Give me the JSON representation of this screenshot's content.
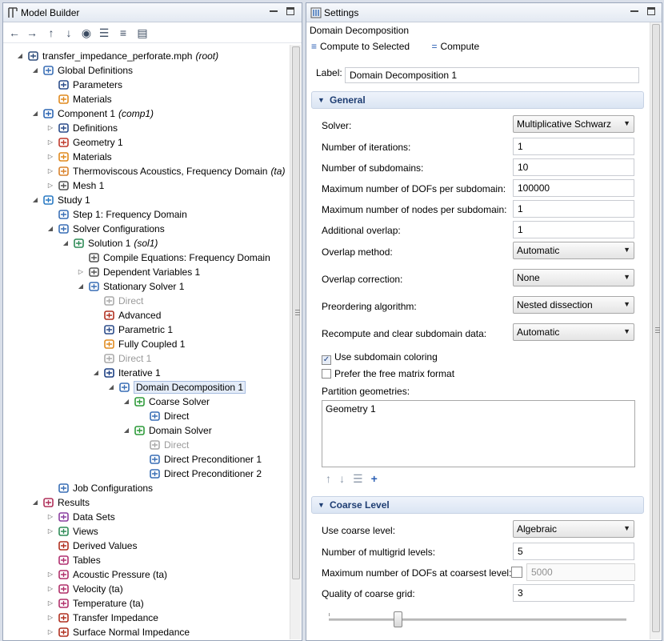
{
  "model_builder": {
    "title": "Model Builder",
    "tree": [
      {
        "label": "transfer_impedance_perforate.mph",
        "suffix": "(root)",
        "icon": "root-file-icon"
      },
      {
        "label": "Global Definitions",
        "icon": "globe-icon"
      },
      {
        "label": "Parameters",
        "icon": "parameters-icon"
      },
      {
        "label": "Materials",
        "icon": "materials-icon"
      },
      {
        "label": "Component 1",
        "suffix": "(comp1)",
        "icon": "component-icon"
      },
      {
        "label": "Definitions",
        "icon": "definitions-icon"
      },
      {
        "label": "Geometry 1",
        "icon": "geometry-icon"
      },
      {
        "label": "Materials",
        "icon": "materials-icon"
      },
      {
        "label": "Thermoviscous Acoustics, Frequency Domain",
        "suffix": "(ta)",
        "icon": "acoustics-physics-icon"
      },
      {
        "label": "Mesh 1",
        "icon": "mesh-icon"
      },
      {
        "label": "Study 1",
        "icon": "study-icon"
      },
      {
        "label": "Step 1: Frequency Domain",
        "icon": "frequency-step-icon"
      },
      {
        "label": "Solver Configurations",
        "icon": "solver-configurations-icon"
      },
      {
        "label": "Solution 1",
        "suffix": "(sol1)",
        "icon": "solution-icon"
      },
      {
        "label": "Compile Equations: Frequency Domain",
        "icon": "compile-equations-icon"
      },
      {
        "label": "Dependent Variables 1",
        "icon": "dependent-variables-icon"
      },
      {
        "label": "Stationary Solver 1",
        "icon": "stationary-solver-icon"
      },
      {
        "label": "Direct",
        "icon": "direct-solver-icon"
      },
      {
        "label": "Advanced",
        "icon": "advanced-icon"
      },
      {
        "label": "Parametric 1",
        "icon": "parametric-icon"
      },
      {
        "label": "Fully Coupled 1",
        "icon": "fully-coupled-icon"
      },
      {
        "label": "Direct 1",
        "icon": "direct-solver-icon"
      },
      {
        "label": "Iterative 1",
        "icon": "iterative-solver-icon"
      },
      {
        "label": "Domain Decomposition 1",
        "icon": "domain-decomposition-icon"
      },
      {
        "label": "Coarse Solver",
        "icon": "coarse-solver-icon"
      },
      {
        "label": "Direct",
        "icon": "direct-solver-icon"
      },
      {
        "label": "Domain Solver",
        "icon": "domain-solver-icon"
      },
      {
        "label": "Direct",
        "icon": "direct-solver-icon"
      },
      {
        "label": "Direct Preconditioner 1",
        "icon": "direct-preconditioner-icon"
      },
      {
        "label": "Direct Preconditioner 2",
        "icon": "direct-preconditioner-icon"
      },
      {
        "label": "Job Configurations",
        "icon": "job-configurations-icon"
      },
      {
        "label": "Results",
        "icon": "results-icon"
      },
      {
        "label": "Data Sets",
        "icon": "data-sets-icon"
      },
      {
        "label": "Views",
        "icon": "views-icon"
      },
      {
        "label": "Derived Values",
        "icon": "derived-values-icon"
      },
      {
        "label": "Tables",
        "icon": "tables-icon"
      },
      {
        "label": "Acoustic Pressure (ta)",
        "icon": "plot-group-3d-icon"
      },
      {
        "label": "Velocity (ta)",
        "icon": "plot-group-3d-icon"
      },
      {
        "label": "Temperature (ta)",
        "icon": "plot-group-3d-icon"
      },
      {
        "label": "Transfer Impedance",
        "icon": "plot-group-1d-icon"
      },
      {
        "label": "Surface Normal Impedance",
        "icon": "plot-group-1d-icon"
      }
    ]
  },
  "settings": {
    "title": "Settings",
    "breadcrumb": "Domain Decomposition",
    "actions": {
      "compute_selected": "Compute to Selected",
      "compute": "Compute"
    },
    "label": {
      "caption": "Label:",
      "value": "Domain Decomposition 1"
    },
    "general": {
      "header": "General",
      "solver_label": "Solver:",
      "solver_value": "Multiplicative Schwarz",
      "iterations_label": "Number of iterations:",
      "iterations_value": "1",
      "subdomains_label": "Number of subdomains:",
      "subdomains_value": "10",
      "max_dofs_label": "Maximum number of DOFs per subdomain:",
      "max_dofs_value": "100000",
      "max_nodes_label": "Maximum number of nodes per subdomain:",
      "max_nodes_value": "1",
      "overlap_label": "Additional overlap:",
      "overlap_value": "1",
      "overlap_method_label": "Overlap method:",
      "overlap_method_value": "Automatic",
      "overlap_correction_label": "Overlap correction:",
      "overlap_correction_value": "None",
      "preordering_label": "Preordering algorithm:",
      "preordering_value": "Nested dissection",
      "recompute_label": "Recompute and clear subdomain data:",
      "recompute_value": "Automatic",
      "use_coloring_label": "Use subdomain coloring",
      "use_coloring_checked": true,
      "free_matrix_label": "Prefer the free matrix format",
      "free_matrix_checked": false,
      "partition_label": "Partition geometries:",
      "partition_items": [
        "Geometry 1"
      ]
    },
    "coarse": {
      "header": "Coarse Level",
      "use_label": "Use coarse level:",
      "use_value": "Algebraic",
      "multigrid_label": "Number of multigrid levels:",
      "multigrid_value": "5",
      "max_dofs_coarse_label": "Maximum number of DOFs at coarsest level:",
      "max_dofs_coarse_value": "5000",
      "quality_label": "Quality of coarse grid:",
      "quality_value": "3",
      "quality_slider_fraction": 0.23
    }
  }
}
